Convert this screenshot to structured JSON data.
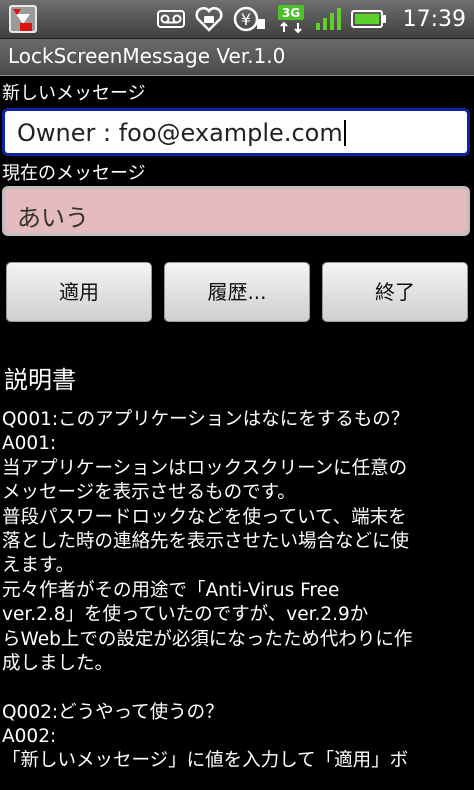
{
  "status_bar": {
    "time": "17:39",
    "network_type": "3G",
    "icons": [
      "app-notification-icon",
      "voicemail-icon",
      "heart-icon",
      "yen-icon",
      "signal-3g-icon",
      "signal-bars-icon",
      "battery-icon"
    ]
  },
  "app": {
    "title": "LockScreenMessage Ver.1.0"
  },
  "form": {
    "new_message_label": "新しいメッセージ",
    "new_message_value": "Owner : foo@example.com",
    "current_message_label": "現在のメッセージ",
    "current_message_value": "あいう"
  },
  "buttons": {
    "apply": "適用",
    "history": "履歴...",
    "exit": "終了"
  },
  "manual": {
    "heading": "説明書",
    "lines": [
      "Q001:このアプリケーションはなにをするもの？",
      "A001:",
      "当アプリケーションはロックスクリーンに任意の",
      "メッセージを表示させるものです。",
      "普段パスワードロックなどを使っていて、端末を",
      "落とした時の連絡先を表示させたい場合などに使",
      "えます。",
      "元々作者がその用途で「Anti-Virus Free",
      "ver.2.8」を使っていたのですが、ver.2.9か",
      "らWeb上での設定が必須になったため代わりに作",
      "成しました。",
      "",
      "Q002:どうやって使うの？",
      "A002:",
      "「新しいメッセージ」に値を入力して「適用」ボ"
    ]
  },
  "colors": {
    "input_border": "#10259c",
    "current_field_bg": "#e4bcbd"
  }
}
